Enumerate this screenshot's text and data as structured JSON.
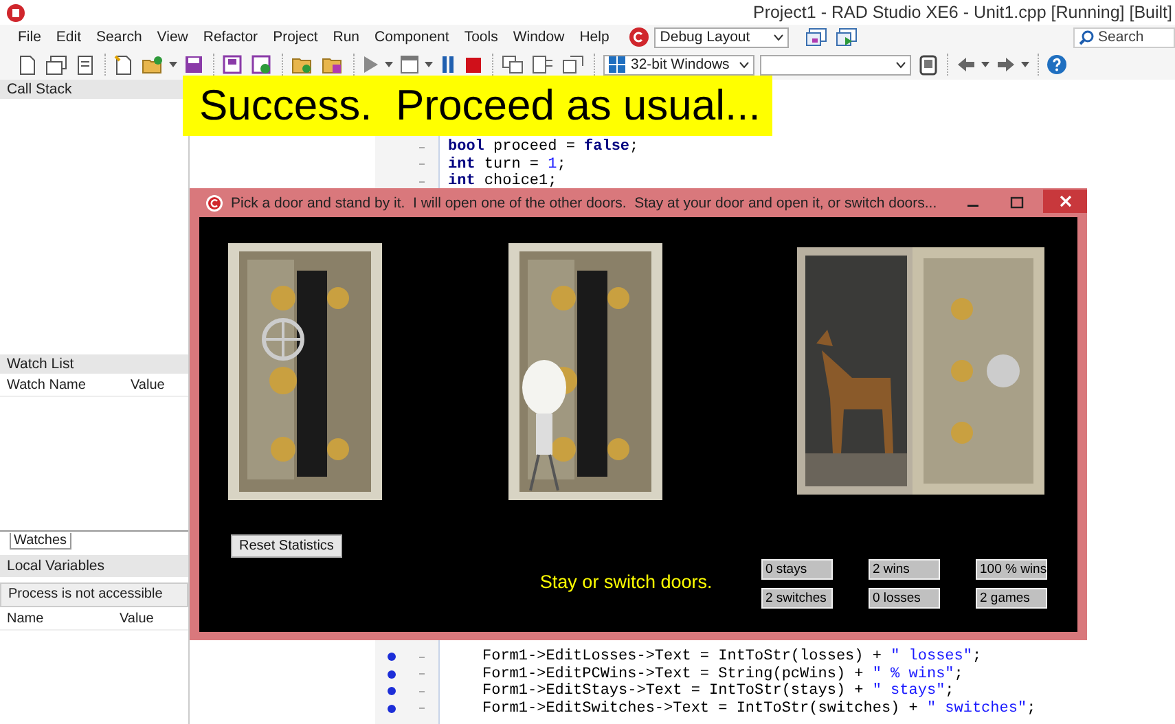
{
  "window": {
    "title": "Project1 - RAD Studio XE6 - Unit1.cpp [Running] [Built]"
  },
  "menu": [
    "File",
    "Edit",
    "Search",
    "View",
    "Refactor",
    "Project",
    "Run",
    "Component",
    "Tools",
    "Window",
    "Help"
  ],
  "layout_dropdown": {
    "value": "Debug Layout"
  },
  "search": {
    "placeholder": "Search"
  },
  "platform_dropdown": {
    "value": "32-bit Windows"
  },
  "call_stack": {
    "title": "Call Stack"
  },
  "watch_list": {
    "title": "Watch List",
    "columns": [
      "Watch Name",
      "Value"
    ],
    "tab": "Watches"
  },
  "local_variables": {
    "title": "Local Variables",
    "status": "Process is not accessible",
    "columns": [
      "Name",
      "Value"
    ]
  },
  "editor": {
    "lines_top": [
      {
        "executable": false,
        "tokens": [
          {
            "kind": "keyword",
            "t": "bool"
          },
          {
            "kind": "plain",
            "t": " proceed = "
          },
          {
            "kind": "keyword",
            "t": "false"
          },
          {
            "kind": "plain",
            "t": ";"
          }
        ]
      },
      {
        "executable": false,
        "tokens": [
          {
            "kind": "keyword",
            "t": "int"
          },
          {
            "kind": "plain",
            "t": " turn = "
          },
          {
            "kind": "number",
            "t": "1"
          },
          {
            "kind": "plain",
            "t": ";"
          }
        ]
      },
      {
        "executable": false,
        "tokens": [
          {
            "kind": "keyword",
            "t": "int"
          },
          {
            "kind": "plain",
            "t": " choice1;"
          }
        ]
      }
    ],
    "lines_bottom": [
      {
        "executable": true,
        "tokens": [
          {
            "kind": "plain",
            "t": "Form1->EditLosses->Text = IntToStr(losses) + "
          },
          {
            "kind": "string",
            "t": "\" losses\""
          },
          {
            "kind": "plain",
            "t": ";"
          }
        ]
      },
      {
        "executable": true,
        "tokens": [
          {
            "kind": "plain",
            "t": "Form1->EditPCWins->Text = String(pcWins) + "
          },
          {
            "kind": "string",
            "t": "\" % wins\""
          },
          {
            "kind": "plain",
            "t": ";"
          }
        ]
      },
      {
        "executable": true,
        "tokens": [
          {
            "kind": "plain",
            "t": "Form1->EditStays->Text = IntToStr(stays) + "
          },
          {
            "kind": "string",
            "t": "\" stays\""
          },
          {
            "kind": "plain",
            "t": ";"
          }
        ]
      },
      {
        "executable": true,
        "tokens": [
          {
            "kind": "plain",
            "t": "Form1->EditSwitches->Text = IntToStr(switches) + "
          },
          {
            "kind": "string",
            "t": "\" switches\""
          },
          {
            "kind": "plain",
            "t": ";"
          }
        ]
      }
    ]
  },
  "banner": {
    "text": "Success.  Proceed as usual..."
  },
  "dialog": {
    "title": "Pick a door and stand by it.  I will open one of the other doors.  Stay at your door and open it, or switch doors...",
    "doors": [
      {
        "kind": "closed"
      },
      {
        "kind": "bulb"
      },
      {
        "kind": "goat"
      }
    ],
    "reset_button": "Reset Statistics",
    "message": "Stay or switch doors.",
    "stats": [
      [
        "0 stays",
        "2 wins",
        "100 % wins"
      ],
      [
        "2 switches",
        "0 losses",
        "2 games"
      ]
    ]
  }
}
